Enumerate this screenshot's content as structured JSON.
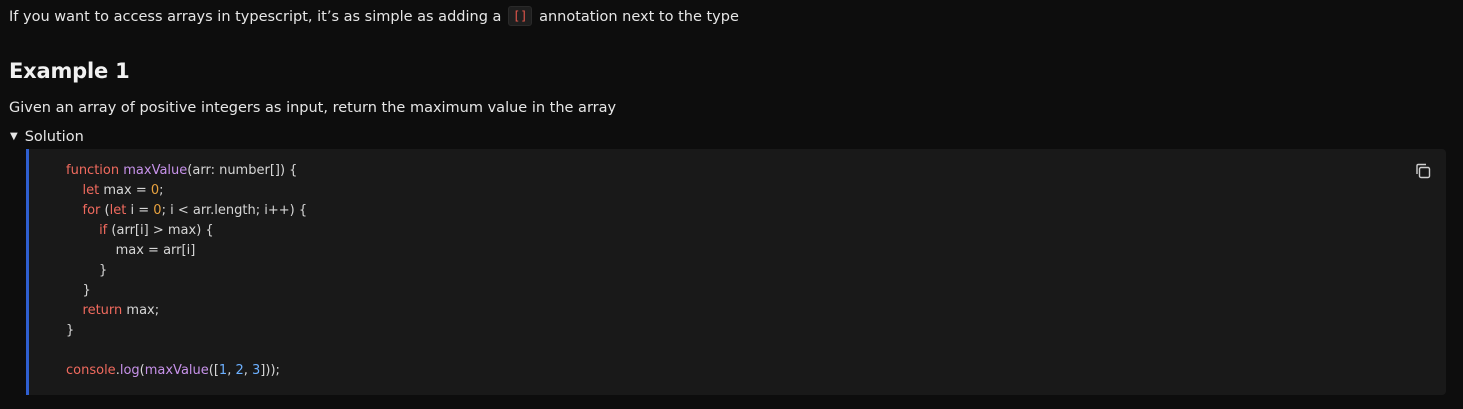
{
  "intro": {
    "text_before": "If you want to access arrays in typescript, it’s as simple as adding a",
    "inline_code": "[]",
    "text_after": "annotation next to the type"
  },
  "section": {
    "heading": "Example 1",
    "description": "Given an array of positive integers as input, return the maximum value in the array"
  },
  "toggle": {
    "label": "Solution",
    "expanded": true
  },
  "code": {
    "language": "typescript",
    "copy_icon": "copy-icon",
    "accent_color": "#2f5fd0",
    "lines": [
      "function maxValue(arr: number[]) {",
      "    let max = 0;",
      "    for (let i = 0; i < arr.length; i++) {",
      "        if (arr[i] > max) {",
      "            max = arr[i]",
      "        }",
      "    }",
      "    return max;",
      "}",
      "",
      "console.log(maxValue([1, 2, 3]));"
    ]
  }
}
